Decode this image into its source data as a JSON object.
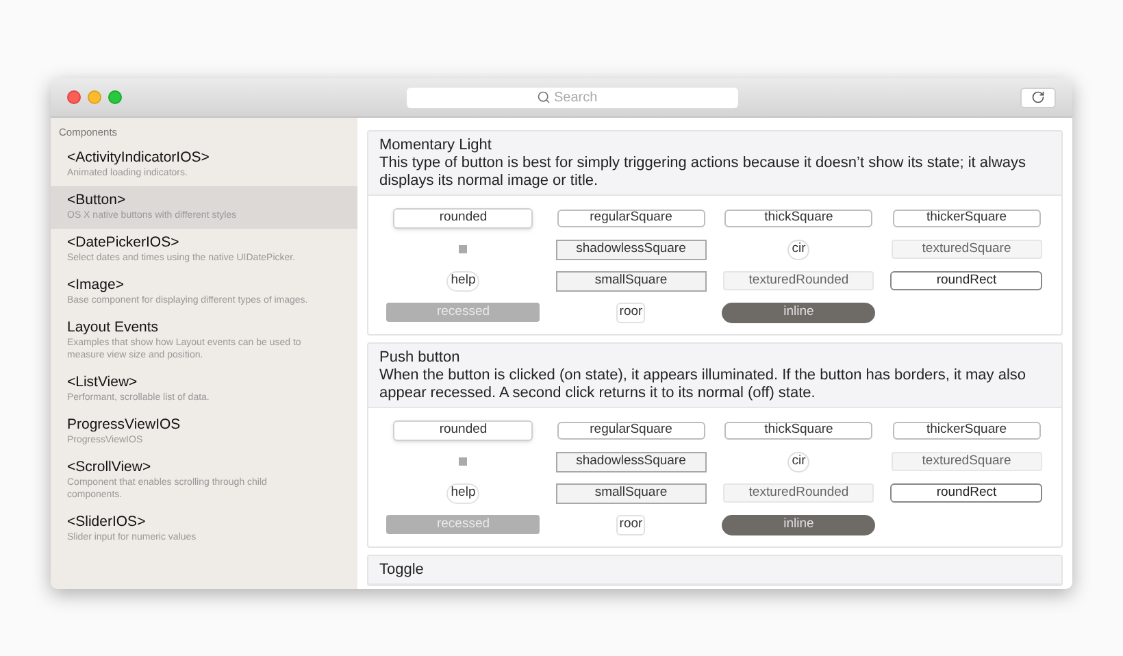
{
  "toolbar": {
    "search": {
      "placeholder": "Search"
    }
  },
  "sidebar": {
    "heading": "Components",
    "items": [
      {
        "title": "<ActivityIndicatorIOS>",
        "description": "Animated loading indicators.",
        "selected": false
      },
      {
        "title": "<Button>",
        "description": "OS X native buttons with different styles",
        "selected": true
      },
      {
        "title": "<DatePickerIOS>",
        "description": "Select dates and times using the native UIDatePicker.",
        "selected": false
      },
      {
        "title": "<Image>",
        "description": "Base component for displaying different types of images.",
        "selected": false
      },
      {
        "title": "Layout Events",
        "description": "Examples that show how Layout events can be used to measure view size and position.",
        "selected": false
      },
      {
        "title": "<ListView>",
        "description": "Performant, scrollable list of data.",
        "selected": false
      },
      {
        "title": "ProgressViewIOS",
        "description": "ProgressViewIOS",
        "selected": false
      },
      {
        "title": "<ScrollView>",
        "description": "Component that enables scrolling through child components.",
        "selected": false
      },
      {
        "title": "<SliderIOS>",
        "description": "Slider input for numeric values",
        "selected": false
      }
    ]
  },
  "sections": [
    {
      "title": "Momentary Light",
      "description": "This type of button is best for simply triggering actions because it doesn’t show its state; it always displays its normal image or title.",
      "buttons": [
        {
          "kind": "rounded",
          "label": "rounded"
        },
        {
          "kind": "regular",
          "label": "regularSquare"
        },
        {
          "kind": "regular",
          "label": "thickSquare"
        },
        {
          "kind": "regular",
          "label": "thickerSquare"
        },
        {
          "kind": "disclosure"
        },
        {
          "kind": "shadowless",
          "label": "shadowlessSquare"
        },
        {
          "kind": "circle",
          "label": "cir"
        },
        {
          "kind": "textured",
          "label": "texturedSquare"
        },
        {
          "kind": "help",
          "label": "help"
        },
        {
          "kind": "shadowless",
          "label": "smallSquare"
        },
        {
          "kind": "textured",
          "label": "texturedRounded"
        },
        {
          "kind": "roundRect",
          "label": "roundRect"
        },
        {
          "kind": "recessed",
          "label": "recessed"
        },
        {
          "kind": "round",
          "label": "roor"
        },
        {
          "kind": "inline",
          "label": "inline"
        }
      ]
    },
    {
      "title": "Push button",
      "description": "When the button is clicked (on state), it appears illuminated. If the button has borders, it may also appear recessed. A second click returns it to its normal (off) state.",
      "buttons": [
        {
          "kind": "rounded",
          "label": "rounded"
        },
        {
          "kind": "regular",
          "label": "regularSquare"
        },
        {
          "kind": "regular",
          "label": "thickSquare"
        },
        {
          "kind": "regular",
          "label": "thickerSquare"
        },
        {
          "kind": "disclosure"
        },
        {
          "kind": "shadowless",
          "label": "shadowlessSquare"
        },
        {
          "kind": "circle",
          "label": "cir"
        },
        {
          "kind": "textured",
          "label": "texturedSquare"
        },
        {
          "kind": "help",
          "label": "help"
        },
        {
          "kind": "shadowless",
          "label": "smallSquare"
        },
        {
          "kind": "textured",
          "label": "texturedRounded"
        },
        {
          "kind": "roundRect",
          "label": "roundRect"
        },
        {
          "kind": "recessed",
          "label": "recessed"
        },
        {
          "kind": "round",
          "label": "roor"
        },
        {
          "kind": "inline",
          "label": "inline"
        }
      ]
    },
    {
      "title": "Toggle"
    }
  ]
}
